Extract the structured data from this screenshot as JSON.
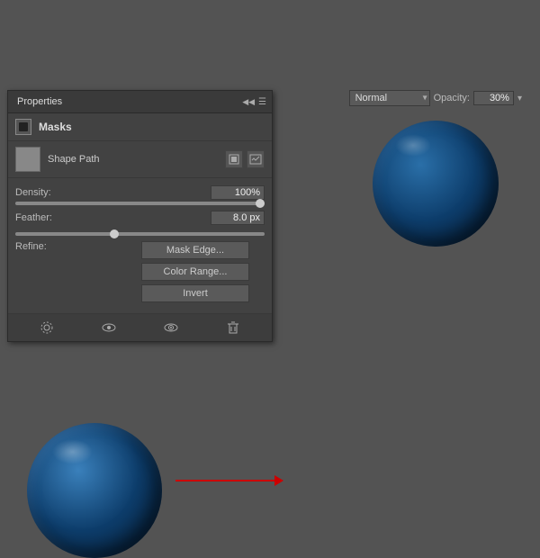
{
  "panel": {
    "title": "Properties",
    "collapse_label": "◀◀",
    "menu_label": "☰",
    "section_masks": "Masks",
    "shape_path_label": "Shape Path",
    "density_label": "Density:",
    "density_value": "100%",
    "feather_label": "Feather:",
    "feather_value": "8.0 px",
    "refine_label": "Refine:",
    "mask_edge_btn": "Mask Edge...",
    "color_range_btn": "Color Range...",
    "invert_btn": "Invert"
  },
  "toolbar": {
    "icon1": "⊙",
    "icon2": "👁",
    "icon3": "👁",
    "icon4": "🗑"
  },
  "blend": {
    "mode_label": "Normal",
    "opacity_label": "Opacity:",
    "opacity_value": "30%"
  },
  "arrow": {
    "direction": "right"
  }
}
